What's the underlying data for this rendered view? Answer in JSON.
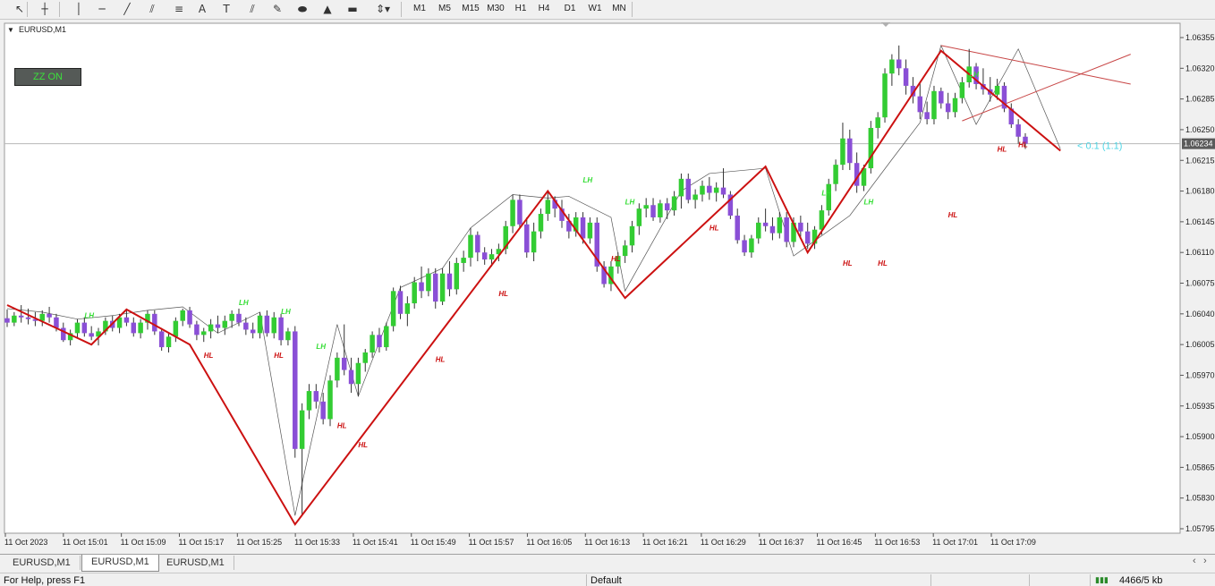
{
  "toolbar": {
    "tools": [
      {
        "icon": "cursor-icon",
        "glyph": "↖"
      },
      {
        "icon": "crosshair-icon",
        "glyph": "┼"
      },
      {
        "icon": "vertical-line-icon",
        "glyph": "│"
      },
      {
        "icon": "horizontal-line-icon",
        "glyph": "─"
      },
      {
        "icon": "trendline-icon",
        "glyph": "╱"
      },
      {
        "icon": "equidistant-channel-icon",
        "glyph": "⫽"
      },
      {
        "icon": "fibonacci-icon",
        "glyph": "≡"
      },
      {
        "icon": "text-icon",
        "glyph": "A"
      },
      {
        "icon": "text-label-icon",
        "glyph": "T"
      },
      {
        "icon": "hatched-lines-icon",
        "glyph": "⫽"
      },
      {
        "icon": "arrow-pen-icon",
        "glyph": "✎"
      },
      {
        "icon": "ellipse-icon",
        "glyph": "⬬"
      },
      {
        "icon": "triangle-icon",
        "glyph": "▲"
      },
      {
        "icon": "rectangle-icon",
        "glyph": "▬"
      },
      {
        "icon": "arrows-menu-icon",
        "glyph": "⇕▾"
      }
    ],
    "timeframes": [
      "M1",
      "M5",
      "M15",
      "M30",
      "H1",
      "H4",
      "D1",
      "W1",
      "MN"
    ]
  },
  "chart": {
    "title": "EURUSD,M1",
    "zz_button": "ZZ ON",
    "current_price_label": "1.06234",
    "fib_label": "< 0.1 (1.1)"
  },
  "tabs": [
    "EURUSD,M1",
    "EURUSD,M1",
    "EURUSD,M1"
  ],
  "active_tab": 1,
  "status": {
    "help": "For Help, press F1",
    "profile": "Default",
    "traffic": "4466/5 kb"
  },
  "colors": {
    "bull": "#33cc33",
    "bear": "#8a4fd6",
    "zigzag": "#cc1111",
    "lh": "#33dd33",
    "hl": "#cc1111",
    "price_label_bg": "#5a5a5a"
  },
  "chart_data": {
    "type": "candlestick",
    "symbol": "EURUSD",
    "timeframe": "M1",
    "ylim": [
      1.05795,
      1.06355
    ],
    "y_ticks": [
      "1.06355",
      "1.06320",
      "1.06285",
      "1.06250",
      "1.06215",
      "1.06180",
      "1.06145",
      "1.06110",
      "1.06075",
      "1.06040",
      "1.06005",
      "1.05970",
      "1.05935",
      "1.05900",
      "1.05865",
      "1.05830",
      "1.05795"
    ],
    "x_ticks": [
      "11 Oct 2023",
      "11 Oct 15:01",
      "11 Oct 15:09",
      "11 Oct 15:17",
      "11 Oct 15:25",
      "11 Oct 15:33",
      "11 Oct 15:41",
      "11 Oct 15:49",
      "11 Oct 15:57",
      "11 Oct 16:05",
      "11 Oct 16:13",
      "11 Oct 16:21",
      "11 Oct 16:29",
      "11 Oct 16:37",
      "11 Oct 16:45",
      "11 Oct 16:53",
      "11 Oct 17:01",
      "11 Oct 17:09"
    ],
    "current_price": 1.06234,
    "candles": [
      [
        1.06035,
        1.06045,
        1.06025,
        1.0603
      ],
      [
        1.0603,
        1.06042,
        1.06026,
        1.06038
      ],
      [
        1.06038,
        1.0605,
        1.0603,
        1.06036
      ],
      [
        1.06036,
        1.06046,
        1.06028,
        1.06034
      ],
      [
        1.06034,
        1.06042,
        1.06026,
        1.06032
      ],
      [
        1.06032,
        1.06044,
        1.06026,
        1.0604
      ],
      [
        1.0604,
        1.06048,
        1.0603,
        1.06036
      ],
      [
        1.06036,
        1.0604,
        1.0602,
        1.06024
      ],
      [
        1.06024,
        1.0603,
        1.06008,
        1.0601
      ],
      [
        1.0601,
        1.06022,
        1.06004,
        1.06018
      ],
      [
        1.06018,
        1.06034,
        1.06012,
        1.0603
      ],
      [
        1.0603,
        1.06036,
        1.06014,
        1.06018
      ],
      [
        1.06018,
        1.06026,
        1.0601,
        1.06014
      ],
      [
        1.06014,
        1.06024,
        1.06004,
        1.0602
      ],
      [
        1.0602,
        1.06036,
        1.06016,
        1.06032
      ],
      [
        1.06032,
        1.06038,
        1.0602,
        1.06024
      ],
      [
        1.06024,
        1.0604,
        1.06018,
        1.06036
      ],
      [
        1.06036,
        1.06046,
        1.06026,
        1.0603
      ],
      [
        1.0603,
        1.06036,
        1.06014,
        1.06018
      ],
      [
        1.06018,
        1.06034,
        1.06012,
        1.0603
      ],
      [
        1.0603,
        1.06044,
        1.06022,
        1.0604
      ],
      [
        1.0604,
        1.06044,
        1.06016,
        1.0602
      ],
      [
        1.0602,
        1.06024,
        1.05998,
        1.06002
      ],
      [
        1.06002,
        1.06018,
        1.05996,
        1.06014
      ],
      [
        1.06014,
        1.06036,
        1.06008,
        1.06032
      ],
      [
        1.06032,
        1.06046,
        1.06026,
        1.06044
      ],
      [
        1.06044,
        1.06048,
        1.06024,
        1.06028
      ],
      [
        1.06028,
        1.06032,
        1.0601,
        1.06016
      ],
      [
        1.06016,
        1.06024,
        1.06008,
        1.0602
      ],
      [
        1.0602,
        1.06034,
        1.06012,
        1.06028
      ],
      [
        1.06028,
        1.06038,
        1.06018,
        1.06024
      ],
      [
        1.06024,
        1.06038,
        1.06016,
        1.06032
      ],
      [
        1.06032,
        1.06044,
        1.06024,
        1.0604
      ],
      [
        1.0604,
        1.06046,
        1.06026,
        1.0603
      ],
      [
        1.0603,
        1.06036,
        1.06016,
        1.06022
      ],
      [
        1.06022,
        1.0603,
        1.06012,
        1.06018
      ],
      [
        1.06018,
        1.06042,
        1.06012,
        1.06038
      ],
      [
        1.06038,
        1.06044,
        1.06014,
        1.06018
      ],
      [
        1.06018,
        1.06042,
        1.06012,
        1.06036
      ],
      [
        1.06036,
        1.0604,
        1.06004,
        1.0601
      ],
      [
        1.0601,
        1.06024,
        1.06004,
        1.0602
      ],
      [
        1.0602,
        1.06026,
        1.05876,
        1.05886
      ],
      [
        1.05886,
        1.05938,
        1.0581,
        1.0593
      ],
      [
        1.0593,
        1.0596,
        1.0592,
        1.05952
      ],
      [
        1.05952,
        1.0596,
        1.05932,
        1.0594
      ],
      [
        1.0594,
        1.0595,
        1.05914,
        1.0592
      ],
      [
        1.0592,
        1.0597,
        1.05912,
        1.05964
      ],
      [
        1.05964,
        1.05996,
        1.05956,
        1.0599
      ],
      [
        1.0599,
        1.06028,
        1.0597,
        1.05976
      ],
      [
        1.05976,
        1.0599,
        1.0595,
        1.0596
      ],
      [
        1.0596,
        1.0599,
        1.05946,
        1.05984
      ],
      [
        1.05984,
        1.06,
        1.05974,
        1.05996
      ],
      [
        1.05996,
        1.0602,
        1.0599,
        1.06016
      ],
      [
        1.06016,
        1.06024,
        1.05996,
        1.06002
      ],
      [
        1.06002,
        1.0603,
        1.05998,
        1.06026
      ],
      [
        1.06026,
        1.0607,
        1.0602,
        1.06066
      ],
      [
        1.06066,
        1.06072,
        1.06034,
        1.0604
      ],
      [
        1.0604,
        1.0606,
        1.06026,
        1.06052
      ],
      [
        1.06052,
        1.06082,
        1.06046,
        1.06076
      ],
      [
        1.06076,
        1.06094,
        1.06058,
        1.06066
      ],
      [
        1.06066,
        1.06092,
        1.0606,
        1.06086
      ],
      [
        1.06086,
        1.06092,
        1.06046,
        1.06054
      ],
      [
        1.06054,
        1.06092,
        1.0605,
        1.06086
      ],
      [
        1.06086,
        1.061,
        1.0606,
        1.06068
      ],
      [
        1.06068,
        1.06104,
        1.06062,
        1.06098
      ],
      [
        1.06098,
        1.06112,
        1.06088,
        1.06104
      ],
      [
        1.06104,
        1.06138,
        1.06094,
        1.0613
      ],
      [
        1.0613,
        1.06134,
        1.061,
        1.0611
      ],
      [
        1.0611,
        1.06116,
        1.06096,
        1.06102
      ],
      [
        1.06102,
        1.06114,
        1.06094,
        1.06108
      ],
      [
        1.06108,
        1.0612,
        1.061,
        1.06114
      ],
      [
        1.06114,
        1.06146,
        1.06108,
        1.0614
      ],
      [
        1.0614,
        1.06176,
        1.06132,
        1.0617
      ],
      [
        1.0617,
        1.06176,
        1.06138,
        1.06142
      ],
      [
        1.06142,
        1.0615,
        1.06104,
        1.0611
      ],
      [
        1.0611,
        1.06144,
        1.061,
        1.06134
      ],
      [
        1.06134,
        1.0616,
        1.06126,
        1.06154
      ],
      [
        1.06154,
        1.0618,
        1.06146,
        1.0617
      ],
      [
        1.0617,
        1.06174,
        1.0615,
        1.0616
      ],
      [
        1.0616,
        1.0617,
        1.06138,
        1.06146
      ],
      [
        1.06146,
        1.06154,
        1.06126,
        1.06134
      ],
      [
        1.06134,
        1.06156,
        1.06128,
        1.0615
      ],
      [
        1.0615,
        1.06156,
        1.0612,
        1.06126
      ],
      [
        1.06126,
        1.0615,
        1.0612,
        1.06144
      ],
      [
        1.06144,
        1.0615,
        1.06088,
        1.06094
      ],
      [
        1.06094,
        1.061,
        1.0607,
        1.06074
      ],
      [
        1.06074,
        1.061,
        1.06066,
        1.06094
      ],
      [
        1.06094,
        1.0611,
        1.06086,
        1.06106
      ],
      [
        1.06106,
        1.06124,
        1.06098,
        1.06118
      ],
      [
        1.06118,
        1.06146,
        1.0611,
        1.0614
      ],
      [
        1.0614,
        1.06166,
        1.0613,
        1.0616
      ],
      [
        1.0616,
        1.06172,
        1.0615,
        1.06164
      ],
      [
        1.06164,
        1.06172,
        1.06146,
        1.0615
      ],
      [
        1.0615,
        1.0617,
        1.06144,
        1.06166
      ],
      [
        1.06166,
        1.06172,
        1.06148,
        1.06158
      ],
      [
        1.06158,
        1.0618,
        1.06152,
        1.06174
      ],
      [
        1.06174,
        1.062,
        1.0616,
        1.06194
      ],
      [
        1.06194,
        1.062,
        1.06166,
        1.0617
      ],
      [
        1.0617,
        1.06182,
        1.0616,
        1.06176
      ],
      [
        1.06176,
        1.06192,
        1.06168,
        1.06186
      ],
      [
        1.06186,
        1.06196,
        1.0617,
        1.06178
      ],
      [
        1.06178,
        1.0619,
        1.06168,
        1.06184
      ],
      [
        1.06184,
        1.06206,
        1.06172,
        1.06176
      ],
      [
        1.06176,
        1.0618,
        1.06148,
        1.06152
      ],
      [
        1.06152,
        1.0616,
        1.0612,
        1.06124
      ],
      [
        1.06124,
        1.0613,
        1.06106,
        1.0611
      ],
      [
        1.0611,
        1.0613,
        1.06104,
        1.06126
      ],
      [
        1.06126,
        1.0615,
        1.0612,
        1.06144
      ],
      [
        1.06144,
        1.0616,
        1.06134,
        1.0614
      ],
      [
        1.0614,
        1.0615,
        1.06124,
        1.06132
      ],
      [
        1.06132,
        1.06156,
        1.06126,
        1.0615
      ],
      [
        1.0615,
        1.06156,
        1.06116,
        1.06122
      ],
      [
        1.06122,
        1.0615,
        1.06116,
        1.06144
      ],
      [
        1.06144,
        1.06152,
        1.06128,
        1.06134
      ],
      [
        1.06134,
        1.06144,
        1.06114,
        1.0612
      ],
      [
        1.0612,
        1.0614,
        1.06114,
        1.06136
      ],
      [
        1.06136,
        1.06164,
        1.0613,
        1.06158
      ],
      [
        1.06158,
        1.06194,
        1.06152,
        1.06188
      ],
      [
        1.06188,
        1.06216,
        1.0618,
        1.0621
      ],
      [
        1.0621,
        1.06258,
        1.06204,
        1.0624
      ],
      [
        1.0624,
        1.0625,
        1.06204,
        1.06212
      ],
      [
        1.06212,
        1.06224,
        1.06178,
        1.06186
      ],
      [
        1.06186,
        1.0621,
        1.0618,
        1.06206
      ],
      [
        1.06206,
        1.0626,
        1.062,
        1.06252
      ],
      [
        1.06252,
        1.0627,
        1.0624,
        1.06264
      ],
      [
        1.06264,
        1.0632,
        1.06258,
        1.06314
      ],
      [
        1.06314,
        1.06336,
        1.063,
        1.0633
      ],
      [
        1.0633,
        1.06346,
        1.06312,
        1.0632
      ],
      [
        1.0632,
        1.0633,
        1.0629,
        1.063
      ],
      [
        1.063,
        1.0631,
        1.0628,
        1.06288
      ],
      [
        1.06288,
        1.06304,
        1.06262,
        1.0627
      ],
      [
        1.0627,
        1.06282,
        1.06256,
        1.06262
      ],
      [
        1.06262,
        1.063,
        1.06256,
        1.06294
      ],
      [
        1.06294,
        1.06298,
        1.06274,
        1.0628
      ],
      [
        1.0628,
        1.06292,
        1.06262,
        1.0627
      ],
      [
        1.0627,
        1.06292,
        1.06264,
        1.06286
      ],
      [
        1.06286,
        1.0631,
        1.0628,
        1.06304
      ],
      [
        1.06304,
        1.06342,
        1.06298,
        1.06322
      ],
      [
        1.06322,
        1.06326,
        1.06296,
        1.06302
      ],
      [
        1.06302,
        1.0632,
        1.0629,
        1.06296
      ],
      [
        1.06296,
        1.0631,
        1.06282,
        1.0629
      ],
      [
        1.0629,
        1.06308,
        1.06284,
        1.063
      ],
      [
        1.063,
        1.06304,
        1.0627,
        1.06274
      ],
      [
        1.06274,
        1.0628,
        1.06252,
        1.06256
      ],
      [
        1.06256,
        1.06262,
        1.06234,
        1.06242
      ],
      [
        1.06242,
        1.06246,
        1.06228,
        1.06234
      ]
    ],
    "zigzag": [
      [
        0,
        1.0605
      ],
      [
        12,
        1.06005
      ],
      [
        17,
        1.06045
      ],
      [
        26,
        1.06005
      ],
      [
        41,
        1.058
      ],
      [
        77,
        1.0618
      ],
      [
        88,
        1.06058
      ],
      [
        108,
        1.06208
      ],
      [
        114,
        1.0611
      ],
      [
        133,
        1.0634
      ],
      [
        150,
        1.06226
      ]
    ],
    "fine_zigzag": [
      [
        0,
        1.06046
      ],
      [
        5,
        1.06042
      ],
      [
        10,
        1.06034
      ],
      [
        15,
        1.06038
      ],
      [
        20,
        1.06044
      ],
      [
        25,
        1.06048
      ],
      [
        30,
        1.06018
      ],
      [
        36,
        1.06042
      ],
      [
        41,
        1.0581
      ],
      [
        47,
        1.06028
      ],
      [
        50,
        1.05946
      ],
      [
        56,
        1.0607
      ],
      [
        62,
        1.06092
      ],
      [
        66,
        1.06138
      ],
      [
        72,
        1.06176
      ],
      [
        77,
        1.06172
      ],
      [
        80,
        1.06174
      ],
      [
        86,
        1.0615
      ],
      [
        88,
        1.06066
      ],
      [
        96,
        1.0618
      ],
      [
        100,
        1.062
      ],
      [
        108,
        1.06206
      ],
      [
        112,
        1.06106
      ],
      [
        120,
        1.06152
      ],
      [
        126,
        1.06216
      ],
      [
        130,
        1.06258
      ],
      [
        133,
        1.06346
      ],
      [
        138,
        1.06256
      ],
      [
        144,
        1.06342
      ],
      [
        150,
        1.06228
      ]
    ],
    "channel_lines": [
      {
        "from": [
          133,
          1.06346
        ],
        "to": [
          160,
          1.06302
        ]
      },
      {
        "from": [
          136,
          1.0626
        ],
        "to": [
          160,
          1.06336
        ]
      }
    ],
    "labels_lh": [
      [
        11,
        1.06035
      ],
      [
        33,
        1.0605
      ],
      [
        39,
        1.0604
      ],
      [
        44,
        1.06
      ],
      [
        82,
        1.0619
      ],
      [
        88,
        1.06165
      ],
      [
        116,
        1.06175
      ],
      [
        122,
        1.06165
      ],
      [
        137,
        1.0631
      ]
    ],
    "labels_hl": [
      [
        28,
        1.0599
      ],
      [
        38,
        1.0599
      ],
      [
        50,
        1.05888
      ],
      [
        47,
        1.0591
      ],
      [
        61,
        1.05985
      ],
      [
        70,
        1.0606
      ],
      [
        86,
        1.061
      ],
      [
        100,
        1.06135
      ],
      [
        119,
        1.06095
      ],
      [
        124,
        1.06095
      ],
      [
        134,
        1.0615
      ],
      [
        141,
        1.06225
      ],
      [
        144,
        1.0623
      ]
    ]
  }
}
